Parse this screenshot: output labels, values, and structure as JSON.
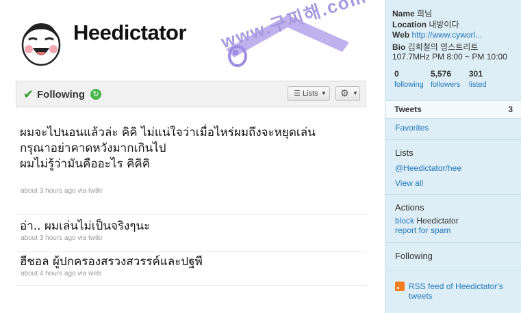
{
  "profile": {
    "username": "Heedictator",
    "watermark": "www.구찌해.com"
  },
  "follow_bar": {
    "status": "Following",
    "lists_label": "Lists"
  },
  "tweets": [
    {
      "text": "ผมจะไปนอนแล้วล่ะ คิคิ ไม่แน่ใจว่าเมื่อไหร่ผมถึงจะหยุดเล่น\nกรุณาอย่าคาดหวังมากเกินไป\nผมไม่รู้ว่ามันคืออะไร คิคิคิ",
      "time": "about 3 hours ago",
      "via_prefix": "via",
      "via": "twtkr"
    },
    {
      "text": "อ่า.. ผมเล่นไม่เป็นจริงๆนะ",
      "time": "about 3 hours ago",
      "via_prefix": "via",
      "via": "twtkr"
    },
    {
      "text": "ฮีชอล ผู้ปกครองสรวงสวรรค์และปฐพี",
      "time": "about 4 hours ago",
      "via_prefix": "via",
      "via": "web"
    }
  ],
  "sidebar": {
    "name_label": "Name",
    "name_value": "희님",
    "location_label": "Location",
    "location_value": "내방이다",
    "web_label": "Web",
    "web_value": "http://www.cyworl...",
    "bio_label": "Bio",
    "bio_value": "김희철의 영스트리트",
    "bio_line2": "107.7MHz PM 8:00 ~ PM 10:00",
    "following_count": "0",
    "following_label": "following",
    "followers_count": "5,576",
    "followers_label": "followers",
    "listed_count": "301",
    "listed_label": "listed",
    "tweets_label": "Tweets",
    "tweets_count": "3",
    "favorites": "Favorites",
    "lists_heading": "Lists",
    "list_link": "@Heedictator/hee",
    "view_all": "View all",
    "actions_heading": "Actions",
    "block_link": "block",
    "block_user": "Heedictator",
    "report_link": "report for spam",
    "following_heading": "Following",
    "rss_text": "RSS feed of Heedictator's tweets"
  }
}
